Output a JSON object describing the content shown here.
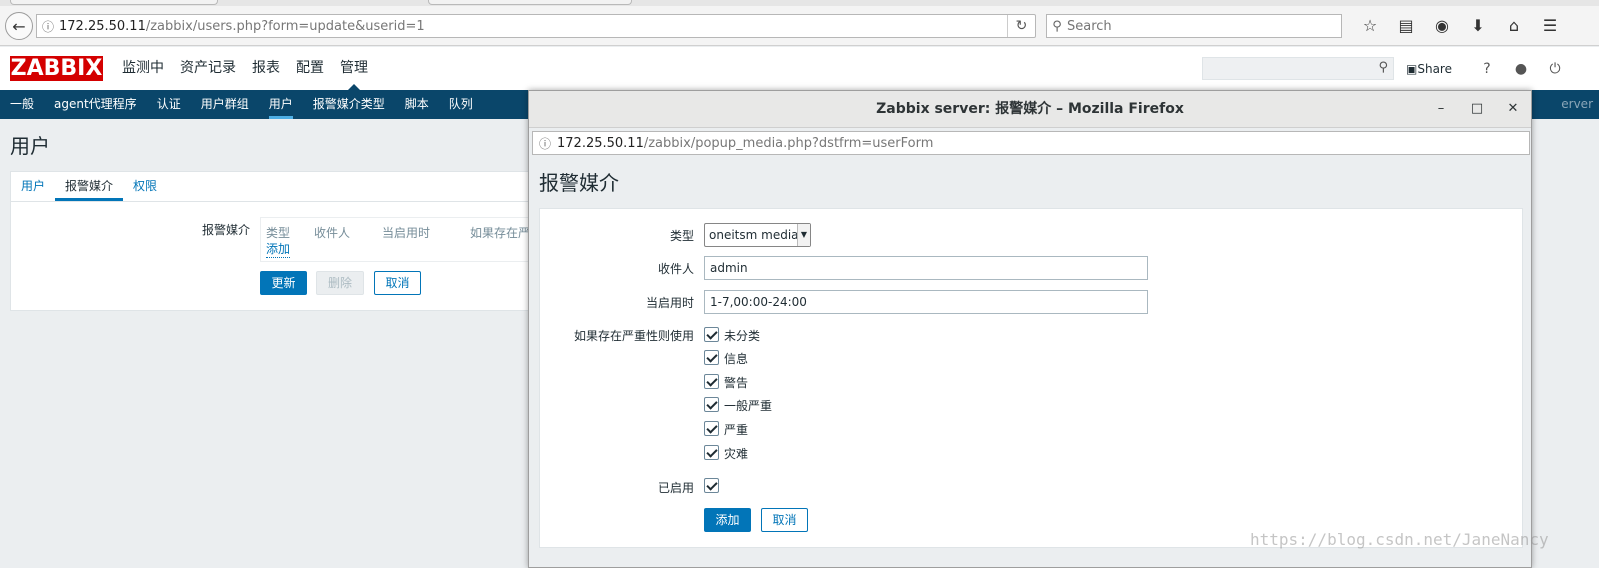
{
  "browser": {
    "url_host": "172.25.50.11",
    "url_path": "/zabbix/users.php?form=update&userid=1",
    "search_placeholder": "Search"
  },
  "header": {
    "logo": "ZABBIX",
    "menu": [
      "监测中",
      "资产记录",
      "报表",
      "配置",
      "管理"
    ],
    "share": "Share",
    "help": "?"
  },
  "submenu": {
    "items": [
      "一般",
      "agent代理程序",
      "认证",
      "用户群组",
      "用户",
      "报警媒介类型",
      "脚本",
      "队列"
    ],
    "server": "erver"
  },
  "page": {
    "title": "用户",
    "tabs": [
      "用户",
      "报警媒介",
      "权限"
    ],
    "media_label": "报警媒介",
    "columns": [
      "类型",
      "收件人",
      "当启用时",
      "如果存在严"
    ],
    "add_link": "添加",
    "update_btn": "更新",
    "delete_btn": "删除",
    "cancel_btn": "取消"
  },
  "popup": {
    "window_title": "Zabbix server: 报警媒介 – Mozilla Firefox",
    "url_host": "172.25.50.11",
    "url_path": "/zabbix/popup_media.php?dstfrm=userForm",
    "title": "报警媒介",
    "type_label": "类型",
    "type_value": "oneitsm media",
    "sendto_label": "收件人",
    "sendto_value": "admin",
    "period_label": "当启用时",
    "period_value": "1-7,00:00-24:00",
    "severity_label": "如果存在严重性则使用",
    "severities": [
      "未分类",
      "信息",
      "警告",
      "一般严重",
      "严重",
      "灾难"
    ],
    "enabled_label": "已启用",
    "add_btn": "添加",
    "cancel_btn": "取消"
  },
  "watermark": "https://blog.csdn.net/JaneNancy"
}
